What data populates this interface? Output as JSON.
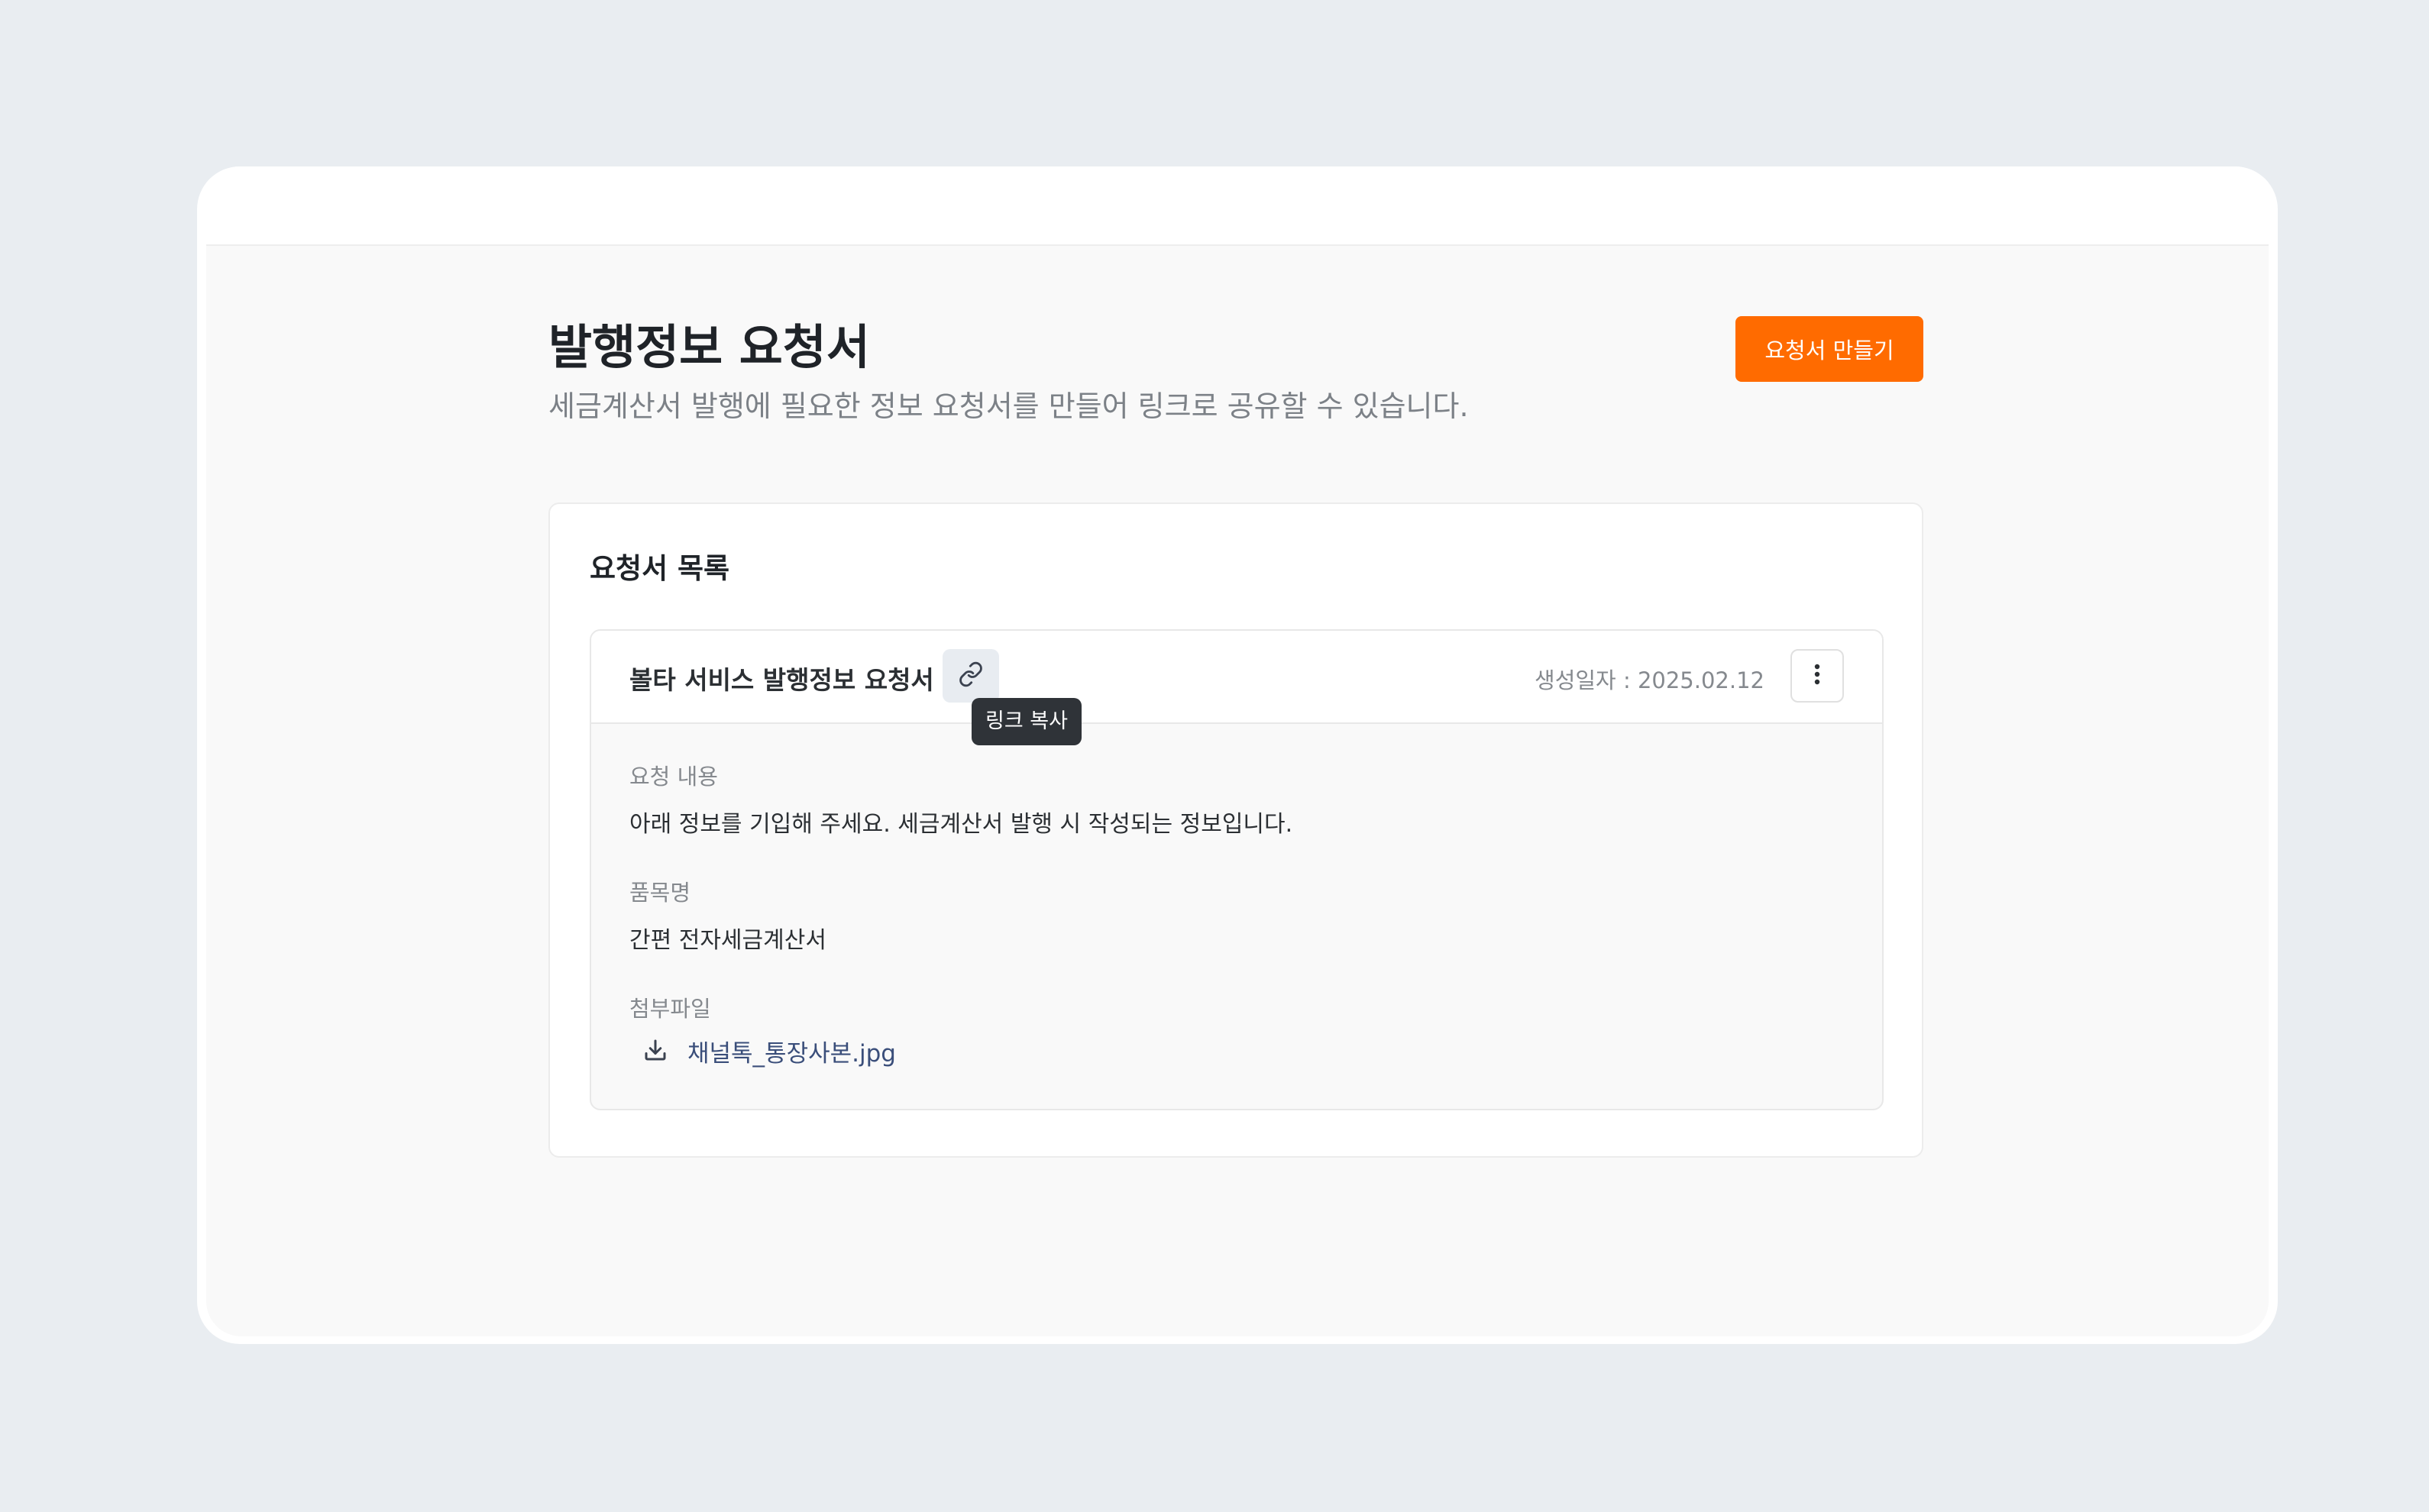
{
  "page": {
    "title": "발행정보 요청서",
    "subtitle": "세금계산서 발행에 필요한 정보 요청서를 만들어 링크로 공유할 수 있습니다.",
    "create_button_label": "요청서 만들기"
  },
  "list": {
    "title": "요청서 목록",
    "items": [
      {
        "name": "볼타 서비스 발행정보 요청서",
        "link_tooltip": "링크 복사",
        "created_date": "생성일자 : 2025.02.12",
        "fields": [
          {
            "label": "요청 내용",
            "value": "아래 정보를 기입해 주세요. 세금계산서 발행 시 작성되는 정보입니다."
          },
          {
            "label": "품목명",
            "value": "간편 전자세금계산서"
          }
        ],
        "attachment_label": "첨부파일",
        "attachment_name": "채널톡_통장사본.jpg"
      }
    ]
  },
  "colors": {
    "accent": "#ff6b00",
    "link": "#3a4e7a",
    "tooltip_bg": "#2f3338"
  },
  "icons": {
    "copy_link": "link-icon",
    "more": "more-vertical-icon",
    "download": "download-icon"
  }
}
